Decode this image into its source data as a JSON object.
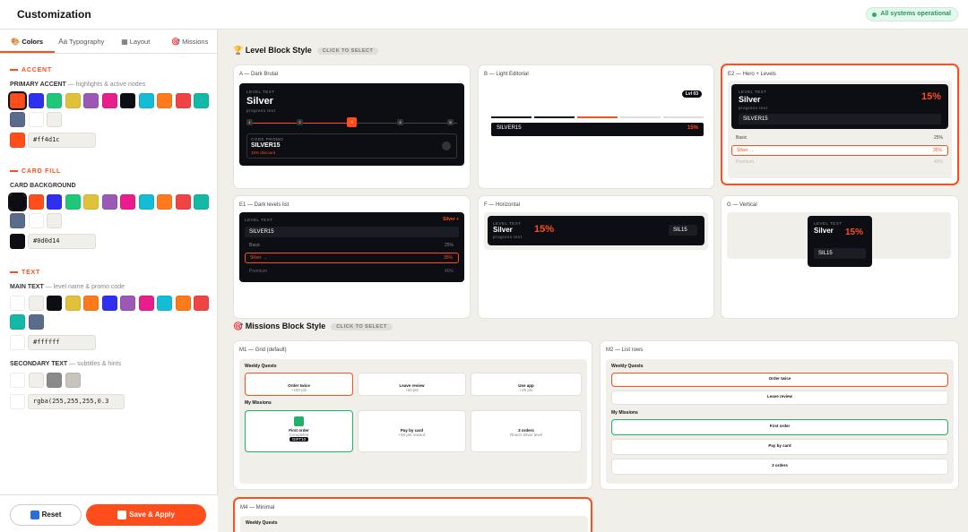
{
  "header": {
    "title": "Customization",
    "status": "All systems operational"
  },
  "tabs": [
    {
      "icon": "🎨",
      "label": "Colors"
    },
    {
      "icon": "Aa",
      "label": "Typography"
    },
    {
      "icon": "▦",
      "label": "Layout"
    },
    {
      "icon": "🎯",
      "label": "Missions"
    }
  ],
  "accent": {
    "section": "ACCENT",
    "label": "PRIMARY ACCENT",
    "hint": "— highlights & active nodes",
    "value": "#ff4d1c",
    "swatches": [
      "#ff4d1c",
      "#2f2ff0",
      "#1fc77a",
      "#e2c13a",
      "#9b59b6",
      "#e91e8c",
      "#0d0d14",
      "#15bcd6",
      "#ff7a1c",
      "#ef4444",
      "#14b8a6",
      "#5b6b8c",
      "#ffffff",
      "#f1efe9"
    ]
  },
  "fill": {
    "section": "CARD FILL",
    "label": "CARD BACKGROUND",
    "value": "#0d0d14",
    "swatches": [
      "#0d0d14",
      "#ff4d1c",
      "#2f2ff0",
      "#1fc77a",
      "#e2c13a",
      "#9b59b6",
      "#e91e8c",
      "#15bcd6",
      "#ff7a1c",
      "#ef4444",
      "#14b8a6",
      "#5b6b8c",
      "#ffffff",
      "#f1efe9"
    ]
  },
  "text": {
    "section": "TEXT",
    "label": "MAIN TEXT",
    "hint": "— level name & promo code",
    "value": "#ffffff",
    "swatches": [
      "#ffffff",
      "#f1efe9",
      "#0d0d14",
      "#e2c13a",
      "#ff7a1c",
      "#2f2ff0",
      "#9b59b6",
      "#e91e8c",
      "#15bcd6",
      "#ff7a1c",
      "#ef4444",
      "#14b8a6",
      "#5b6b8c"
    ],
    "secondary_label": "SECONDARY TEXT",
    "secondary_hint": "— subtitles & hints",
    "secondary_value": "rgba(255,255,255,0.3",
    "secondary_swatches": [
      "#ffffff",
      "#f1efe9",
      "#8a8a8a",
      "#c7c4bd"
    ]
  },
  "buttons": {
    "reset": "Reset",
    "save": "Save & Apply"
  },
  "level_section": {
    "title": "Level Block Style",
    "pill": "CLICK TO SELECT",
    "cards": [
      {
        "label": "A — Dark Brutal"
      },
      {
        "label": "B — Light Editorial"
      },
      {
        "label": "E2 — Hero + Levels"
      },
      {
        "label": "E1 — Dark levels list"
      },
      {
        "label": "F — Horizontal"
      },
      {
        "label": "G — Vertical"
      }
    ],
    "preview": {
      "level_text": "LEVEL TEXT",
      "level_name": "Silver",
      "progress": "progress text",
      "promo_label": "CODE PROMO",
      "code": "SILVER15",
      "code_short": "SIL15",
      "discount": "15% discount",
      "pct": "15%",
      "lvl": "Lvl 03",
      "basic": "Basic",
      "basic_pct": "25%",
      "silver": "Silver →",
      "silver_pct": "35%",
      "premium": "Premium",
      "premium_pct": "40%",
      "silver_plus": "Silver +",
      "steps": [
        "1",
        "2",
        "3",
        "4",
        "5"
      ]
    }
  },
  "missions_section": {
    "title": "Missions Block Style",
    "pill": "CLICK TO SELECT",
    "cards": [
      {
        "label": "M1 — Grid (default)"
      },
      {
        "label": "M2 — List rows"
      },
      {
        "label": "M4 — Minimal"
      }
    ],
    "weekly": "Weekly Quests",
    "my": "My Missions",
    "order_twice": "Order twice",
    "order_twice_sub": "+100 pts",
    "leave_review": "Leave review",
    "leave_review_sub": "+50 pts",
    "use_app": "Use app",
    "use_app_sub": "+25 pts",
    "first_order": "First order",
    "first_order_sub": "Completed",
    "gift": "GIFT10",
    "pay_card": "Pay by card",
    "pay_card_sub": "+50 pts reward",
    "three_orders": "3 orders",
    "three_orders_sub": "Reach Silver level"
  }
}
